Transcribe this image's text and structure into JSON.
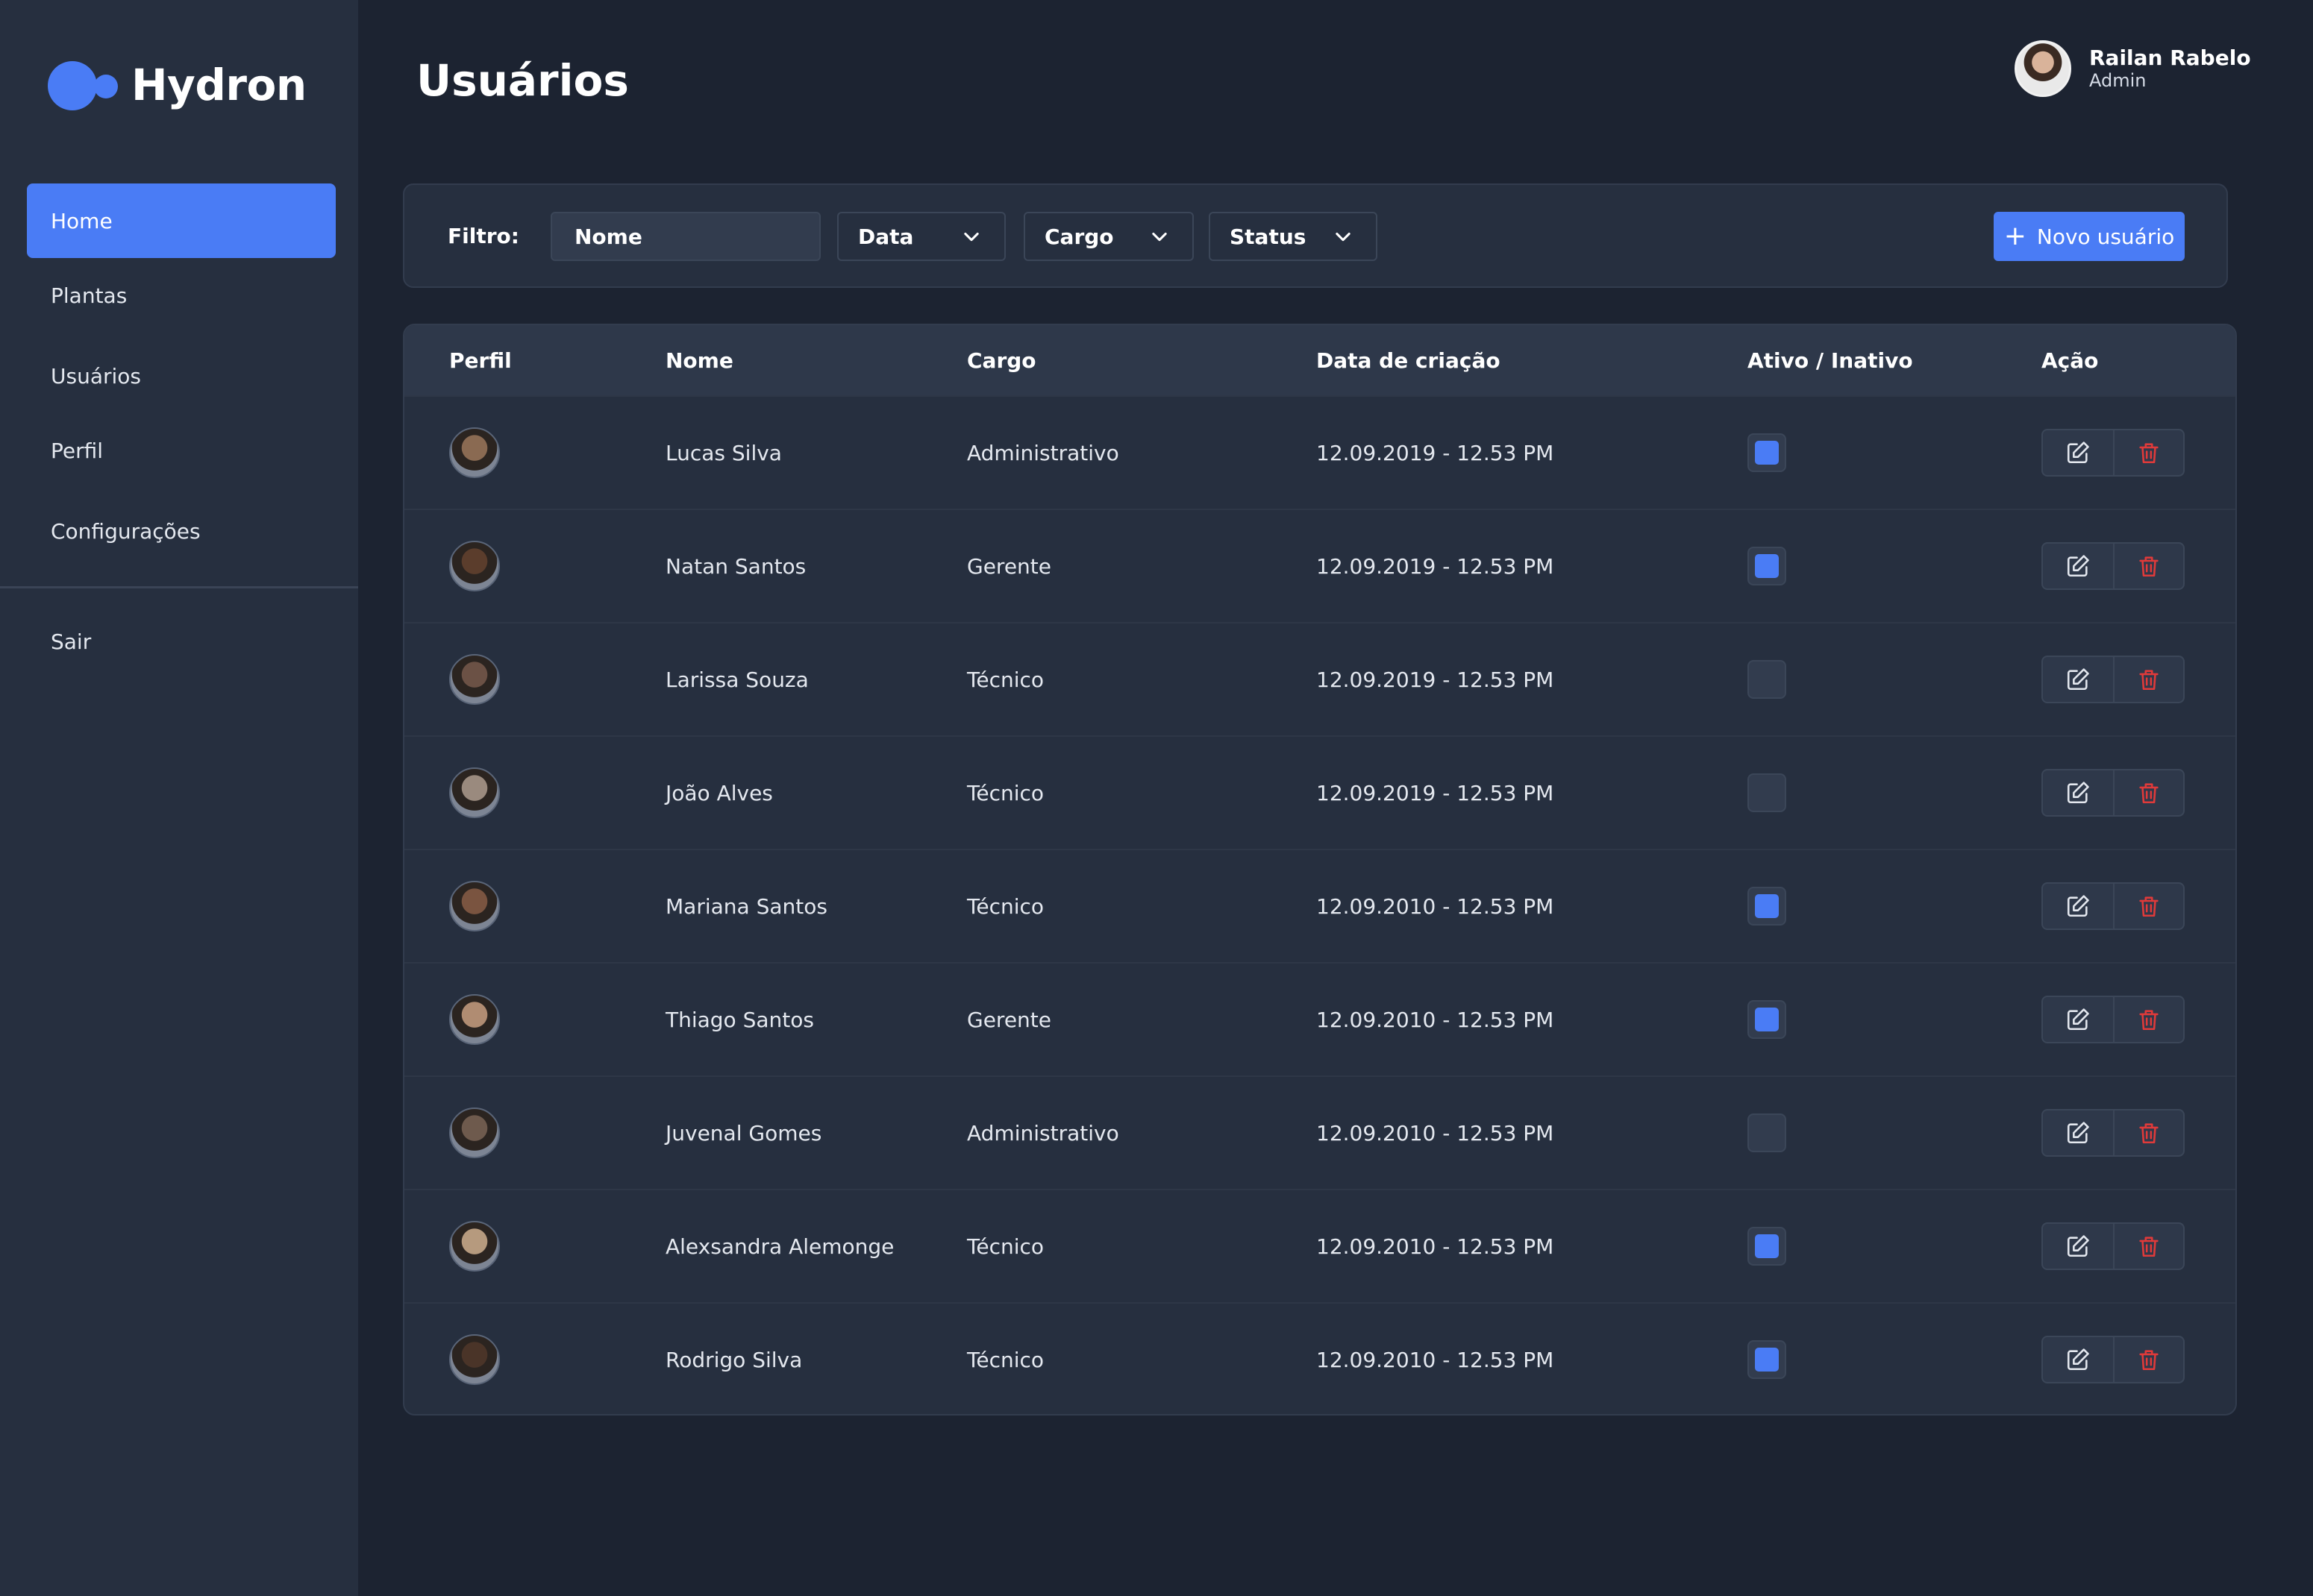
{
  "app": {
    "name": "Hydron"
  },
  "colors": {
    "accent": "#4a7cf5",
    "danger": "#e03a3a",
    "bg": "#1c2331",
    "panel": "#262f3f"
  },
  "sidebar": {
    "items": [
      {
        "label": "Home",
        "active": true
      },
      {
        "label": "Plantas"
      },
      {
        "label": "Usuários"
      },
      {
        "label": "Perfil"
      },
      {
        "label": "Configurações"
      },
      {
        "label": "Sair"
      }
    ]
  },
  "header": {
    "title": "Usuários"
  },
  "user": {
    "name": "Railan Rabelo",
    "role": "Admin"
  },
  "filter": {
    "label": "Filtro:",
    "name_value": "Nome",
    "date_select": "Data",
    "role_select": "Cargo",
    "status_select": "Status",
    "new_user_label": "Novo usuário"
  },
  "table": {
    "columns": [
      "Perfil",
      "Nome",
      "Cargo",
      "Data de criação",
      "Ativo / Inativo",
      "Ação"
    ],
    "rows": [
      {
        "name": "Lucas Silva",
        "role": "Administrativo",
        "created": "12.09.2019 - 12.53 PM",
        "active": true
      },
      {
        "name": "Natan Santos",
        "role": "Gerente",
        "created": "12.09.2019 - 12.53 PM",
        "active": true
      },
      {
        "name": "Larissa Souza",
        "role": "Técnico",
        "created": "12.09.2019 - 12.53 PM",
        "active": false
      },
      {
        "name": "João Alves",
        "role": "Técnico",
        "created": "12.09.2019 - 12.53 PM",
        "active": false
      },
      {
        "name": "Mariana Santos",
        "role": "Técnico",
        "created": "12.09.2010 - 12.53 PM",
        "active": true
      },
      {
        "name": "Thiago Santos",
        "role": "Gerente",
        "created": "12.09.2010 - 12.53 PM",
        "active": true
      },
      {
        "name": "Juvenal Gomes",
        "role": "Administrativo",
        "created": "12.09.2010 - 12.53 PM",
        "active": false
      },
      {
        "name": "Alexsandra Alemonge",
        "role": "Técnico",
        "created": "12.09.2010 - 12.53 PM",
        "active": true
      },
      {
        "name": "Rodrigo Silva",
        "role": "Técnico",
        "created": "12.09.2010 - 12.53 PM",
        "active": true
      }
    ]
  },
  "icons": {
    "edit": "edit-icon",
    "delete": "trash-icon",
    "dropdown": "chevron-down-icon",
    "add": "plus-icon"
  }
}
